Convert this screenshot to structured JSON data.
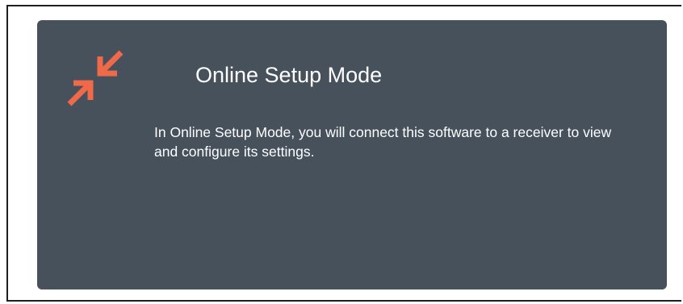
{
  "online_mode": {
    "title": "Online Setup Mode",
    "description": "In Online Setup Mode, you will connect this software to a receiver to view and configure its settings.",
    "icon": "arrows-inward-icon",
    "accent_color": "#f06a4a",
    "card_color": "#46515c"
  }
}
